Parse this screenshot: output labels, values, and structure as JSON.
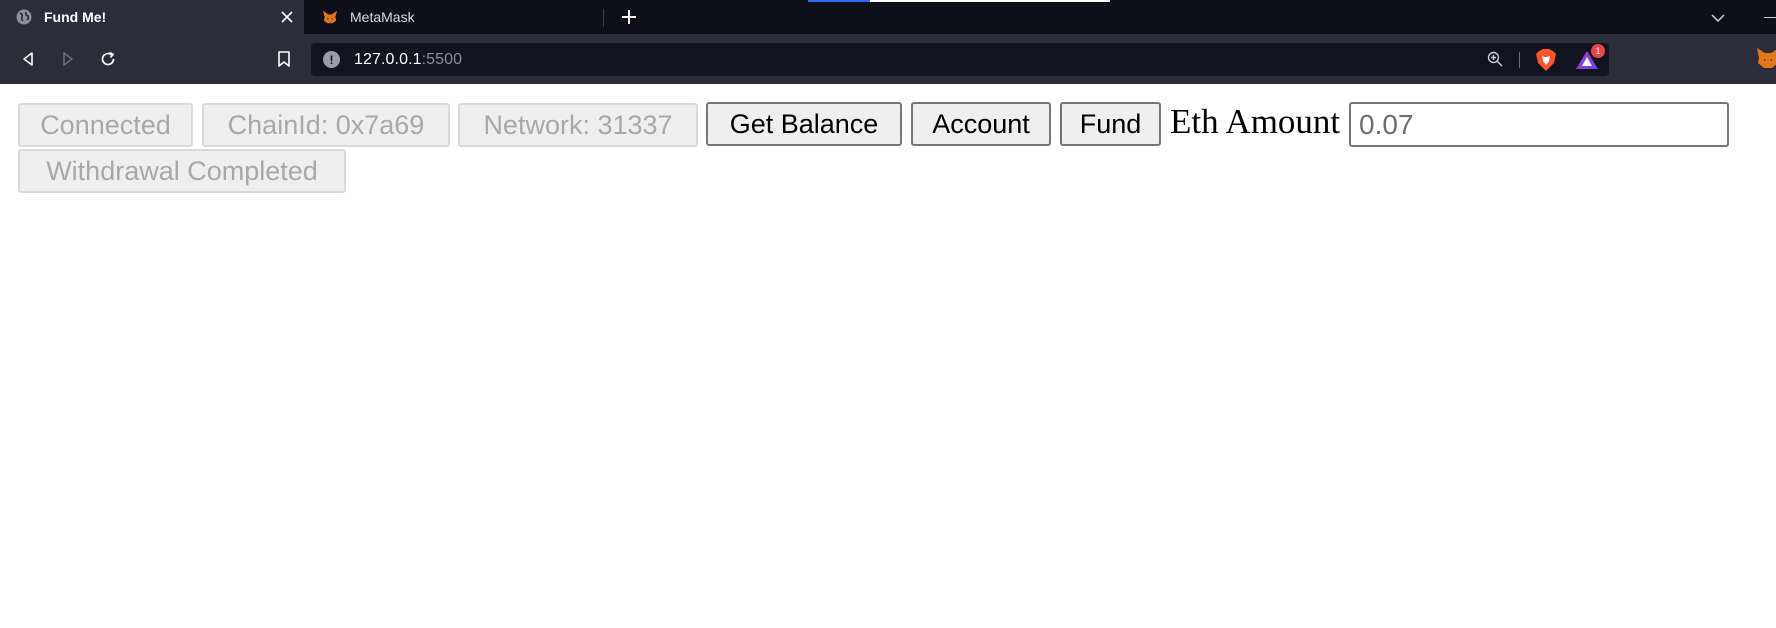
{
  "browser": {
    "tabs": [
      {
        "title": "Fund Me!",
        "icon": "globe-icon",
        "active": true
      },
      {
        "title": "MetaMask",
        "icon": "metamask-fox-icon",
        "active": false
      }
    ],
    "url": {
      "host": "127.0.0.1",
      "port": ":5500"
    },
    "rewards_badge": "1",
    "colors": {
      "tabstrip_bg": "#0e0f1a",
      "toolbar_bg": "#2b2d3b",
      "urlbar_bg": "#111320"
    }
  },
  "page": {
    "buttons": {
      "connected": "Connected",
      "chain_id": "ChainId: 0x7a69",
      "network": "Network: 31337",
      "get_balance": "Get Balance",
      "account": "Account",
      "fund": "Fund",
      "withdrawal": "Withdrawal Completed"
    },
    "eth_amount_label": "Eth Amount",
    "eth_amount_value": "0.07"
  }
}
